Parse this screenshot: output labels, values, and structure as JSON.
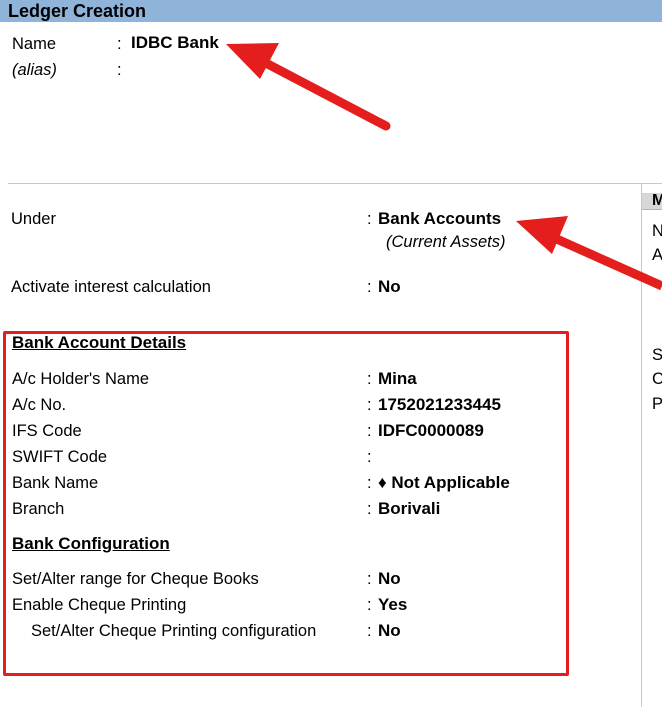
{
  "window": {
    "title": "Ledger Creation"
  },
  "name_section": {
    "name_label": "Name",
    "name_colon": ":",
    "name_value": "IDBC Bank",
    "alias_label": "(alias)",
    "alias_colon": ":"
  },
  "main": {
    "under_label": "Under",
    "under_colon": ":",
    "under_value": "Bank Accounts",
    "under_subvalue": "(Current Assets)",
    "interest_label": "Activate interest calculation",
    "interest_colon": ":",
    "interest_value": "No"
  },
  "bank_account_details": {
    "heading": "Bank Account Details",
    "rows": [
      {
        "label": "A/c Holder's Name",
        "colon": ":",
        "value": "Mina"
      },
      {
        "label": "A/c No.",
        "colon": ":",
        "value": "1752021233445"
      },
      {
        "label": "IFS Code",
        "colon": ":",
        "value": "IDFC0000089"
      },
      {
        "label": "SWIFT Code",
        "colon": ":",
        "value": ""
      },
      {
        "label": "Bank Name",
        "colon": ":",
        "value": "♦ Not Applicable"
      },
      {
        "label": "Branch",
        "colon": ":",
        "value": "Borivali"
      }
    ]
  },
  "bank_configuration": {
    "heading": "Bank Configuration",
    "rows": [
      {
        "label": "Set/Alter range for Cheque Books",
        "colon": ":",
        "value": "No"
      },
      {
        "label": "Enable Cheque Printing",
        "colon": ":",
        "value": "Yes"
      },
      {
        "label": "Set/Alter Cheque Printing configuration",
        "colon": ":",
        "value": "No"
      }
    ]
  },
  "right_panel": {
    "title_fragment": "M",
    "line1": "N",
    "line2": "A",
    "line3": "S",
    "line4": "C",
    "line5": "P"
  },
  "colors": {
    "titlebar": "#8fb3d9",
    "annotation_red": "#e41d1d"
  }
}
